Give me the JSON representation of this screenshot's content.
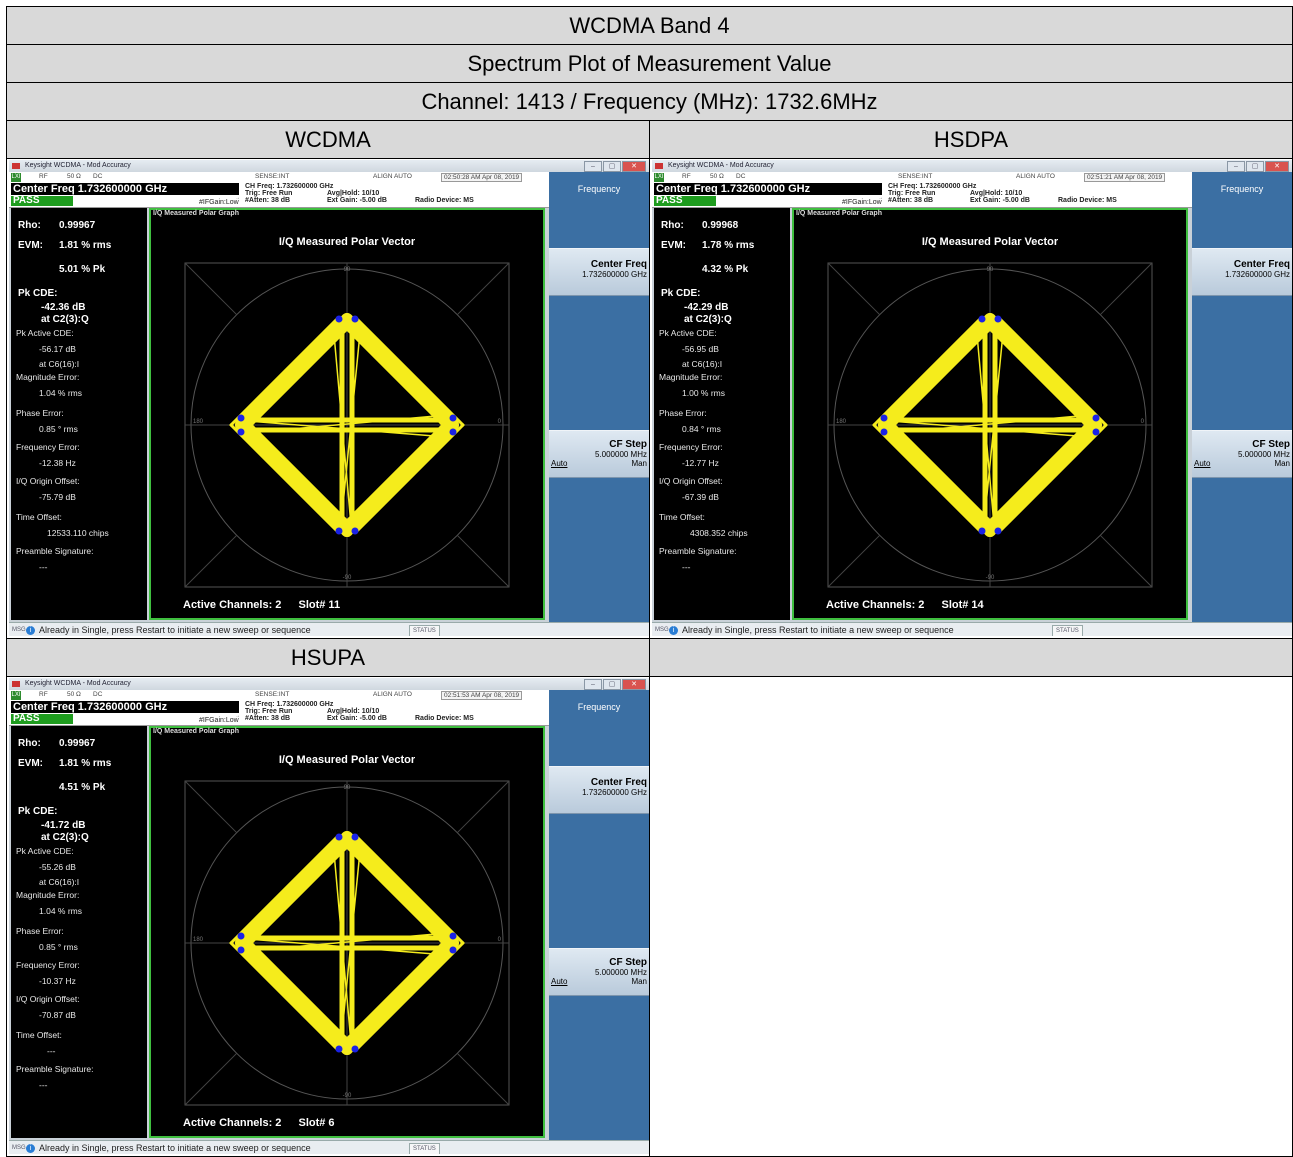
{
  "doc": {
    "title": "WCDMA Band 4",
    "subtitle": "Spectrum Plot of Measurement Value",
    "channel_line": "Channel: 1413 / Frequency (MHz): 1732.6MHz",
    "col_headers": [
      "WCDMA",
      "HSDPA",
      "HSUPA",
      ""
    ]
  },
  "panels": [
    {
      "window_title": "Keysight WCDMA - Mod Accuracy",
      "marker": "LXI",
      "rf_strip": {
        "rf": "RF",
        "ohm": "50 Ω",
        "coupling": "DC",
        "sense": "SENSE:INT",
        "align": "ALIGN AUTO",
        "timestamp": "02:50:28 AM Apr 08, 2019"
      },
      "center_freq": "Center Freq 1.732600000 GHz",
      "pass": "PASS",
      "ch_freq": "CH Freq: 1.732600000 GHz",
      "trig": "Trig: Free Run",
      "avg_hold": "Avg|Hold: 10/10",
      "ifgain": "#IFGain:Low",
      "atten": "#Atten: 38 dB",
      "ext_gain": "Ext Gain: -5.00 dB",
      "radio_device": "Radio Device: MS",
      "results": {
        "rho_label": "Rho:",
        "rho": "0.99967",
        "evm_label": "EVM:",
        "evm_rms": "1.81 % rms",
        "evm_pk": "5.01 % Pk",
        "pkcde_label": "Pk CDE:",
        "pkcde": "-42.36 dB",
        "pkcde_at": "at C2(3):Q",
        "pk_active_label": "Pk Active CDE:",
        "pk_active": "-56.17 dB",
        "pk_active_at": "at C6(16):I",
        "mag_label": "Magnitude Error:",
        "mag": "1.04 % rms",
        "phase_label": "Phase Error:",
        "phase": "0.85 ° rms",
        "freq_label": "Frequency Error:",
        "freq": "-12.38 Hz",
        "iq_label": "I/Q Origin Offset:",
        "iq": "-75.79 dB",
        "time_label": "Time Offset:",
        "time": "12533.110 chips",
        "preamble_label": "Preamble Signature:",
        "preamble": "---"
      },
      "graph_window_title": "I/Q Measured Polar Graph",
      "plot_title": "I/Q Measured Polar Vector",
      "axis_ticks": {
        "top": "90",
        "left": "180",
        "right": "0",
        "bottom": "-90"
      },
      "active_channels": "Active Channels: 2",
      "slot": "Slot# 11",
      "softkeys": {
        "title": "Frequency",
        "center_freq_label": "Center Freq",
        "center_freq_value": "1.732600000 GHz",
        "cf_step_label": "CF Step",
        "cf_step_value": "5.000000 MHz",
        "auto": "Auto",
        "man": "Man"
      },
      "msg_label": "MSG",
      "message": "Already in Single, press Restart to initiate a new sweep or sequence",
      "status": "STATUS"
    },
    {
      "window_title": "Keysight WCDMA - Mod Accuracy",
      "marker": "LXI",
      "rf_strip": {
        "rf": "RF",
        "ohm": "50 Ω",
        "coupling": "DC",
        "sense": "SENSE:INT",
        "align": "ALIGN AUTO",
        "timestamp": "02:51:21 AM Apr 08, 2019"
      },
      "center_freq": "Center Freq 1.732600000 GHz",
      "pass": "PASS",
      "ch_freq": "CH Freq: 1.732600000 GHz",
      "trig": "Trig: Free Run",
      "avg_hold": "Avg|Hold: 10/10",
      "ifgain": "#IFGain:Low",
      "atten": "#Atten: 38 dB",
      "ext_gain": "Ext Gain: -5.00 dB",
      "radio_device": "Radio Device: MS",
      "results": {
        "rho_label": "Rho:",
        "rho": "0.99968",
        "evm_label": "EVM:",
        "evm_rms": "1.78 % rms",
        "evm_pk": "4.32 % Pk",
        "pkcde_label": "Pk CDE:",
        "pkcde": "-42.29 dB",
        "pkcde_at": "at C2(3):Q",
        "pk_active_label": "Pk Active CDE:",
        "pk_active": "-56.95 dB",
        "pk_active_at": "at C6(16):I",
        "mag_label": "Magnitude Error:",
        "mag": "1.00 % rms",
        "phase_label": "Phase Error:",
        "phase": "0.84 ° rms",
        "freq_label": "Frequency Error:",
        "freq": "-12.77 Hz",
        "iq_label": "I/Q Origin Offset:",
        "iq": "-67.39 dB",
        "time_label": "Time Offset:",
        "time": "4308.352 chips",
        "preamble_label": "Preamble Signature:",
        "preamble": "---"
      },
      "graph_window_title": "I/Q Measured Polar Graph",
      "plot_title": "I/Q Measured Polar Vector",
      "axis_ticks": {
        "top": "90",
        "left": "180",
        "right": "0",
        "bottom": "-90"
      },
      "active_channels": "Active Channels: 2",
      "slot": "Slot# 14",
      "softkeys": {
        "title": "Frequency",
        "center_freq_label": "Center Freq",
        "center_freq_value": "1.732600000 GHz",
        "cf_step_label": "CF Step",
        "cf_step_value": "5.000000 MHz",
        "auto": "Auto",
        "man": "Man"
      },
      "msg_label": "MSG",
      "message": "Already in Single, press Restart to initiate a new sweep or sequence",
      "status": "STATUS"
    },
    {
      "window_title": "Keysight WCDMA - Mod Accuracy",
      "marker": "LXI",
      "rf_strip": {
        "rf": "RF",
        "ohm": "50 Ω",
        "coupling": "DC",
        "sense": "SENSE:INT",
        "align": "ALIGN AUTO",
        "timestamp": "02:51:53 AM Apr 08, 2019"
      },
      "center_freq": "Center Freq 1.732600000 GHz",
      "pass": "PASS",
      "ch_freq": "CH Freq: 1.732600000 GHz",
      "trig": "Trig: Free Run",
      "avg_hold": "Avg|Hold: 10/10",
      "ifgain": "#IFGain:Low",
      "atten": "#Atten: 38 dB",
      "ext_gain": "Ext Gain: -5.00 dB",
      "radio_device": "Radio Device: MS",
      "results": {
        "rho_label": "Rho:",
        "rho": "0.99967",
        "evm_label": "EVM:",
        "evm_rms": "1.81 % rms",
        "evm_pk": "4.51 % Pk",
        "pkcde_label": "Pk CDE:",
        "pkcde": "-41.72 dB",
        "pkcde_at": "at C2(3):Q",
        "pk_active_label": "Pk Active CDE:",
        "pk_active": "-55.26 dB",
        "pk_active_at": "at C6(16):I",
        "mag_label": "Magnitude Error:",
        "mag": "1.04 % rms",
        "phase_label": "Phase Error:",
        "phase": "0.85 ° rms",
        "freq_label": "Frequency Error:",
        "freq": "-10.37 Hz",
        "iq_label": "I/Q Origin Offset:",
        "iq": "-70.87 dB",
        "time_label": "Time Offset:",
        "time": "---",
        "preamble_label": "Preamble Signature:",
        "preamble": "---"
      },
      "graph_window_title": "I/Q Measured Polar Graph",
      "plot_title": "I/Q Measured Polar Vector",
      "axis_ticks": {
        "top": "90",
        "left": "180",
        "right": "0",
        "bottom": "-90"
      },
      "active_channels": "Active Channels: 2",
      "slot": "Slot# 6",
      "softkeys": {
        "title": "Frequency",
        "center_freq_label": "Center Freq",
        "center_freq_value": "1.732600000 GHz",
        "cf_step_label": "CF Step",
        "cf_step_value": "5.000000 MHz",
        "auto": "Auto",
        "man": "Man"
      },
      "msg_label": "MSG",
      "message": "Already in Single, press Restart to initiate a new sweep or sequence",
      "status": "STATUS"
    }
  ],
  "colors": {
    "trace": "#f5ec1c",
    "symbol": "#1a22e6",
    "pass": "#1e9c1e",
    "softkey_bg": "#3b6fa3",
    "graph_border": "#3fbf3f"
  }
}
